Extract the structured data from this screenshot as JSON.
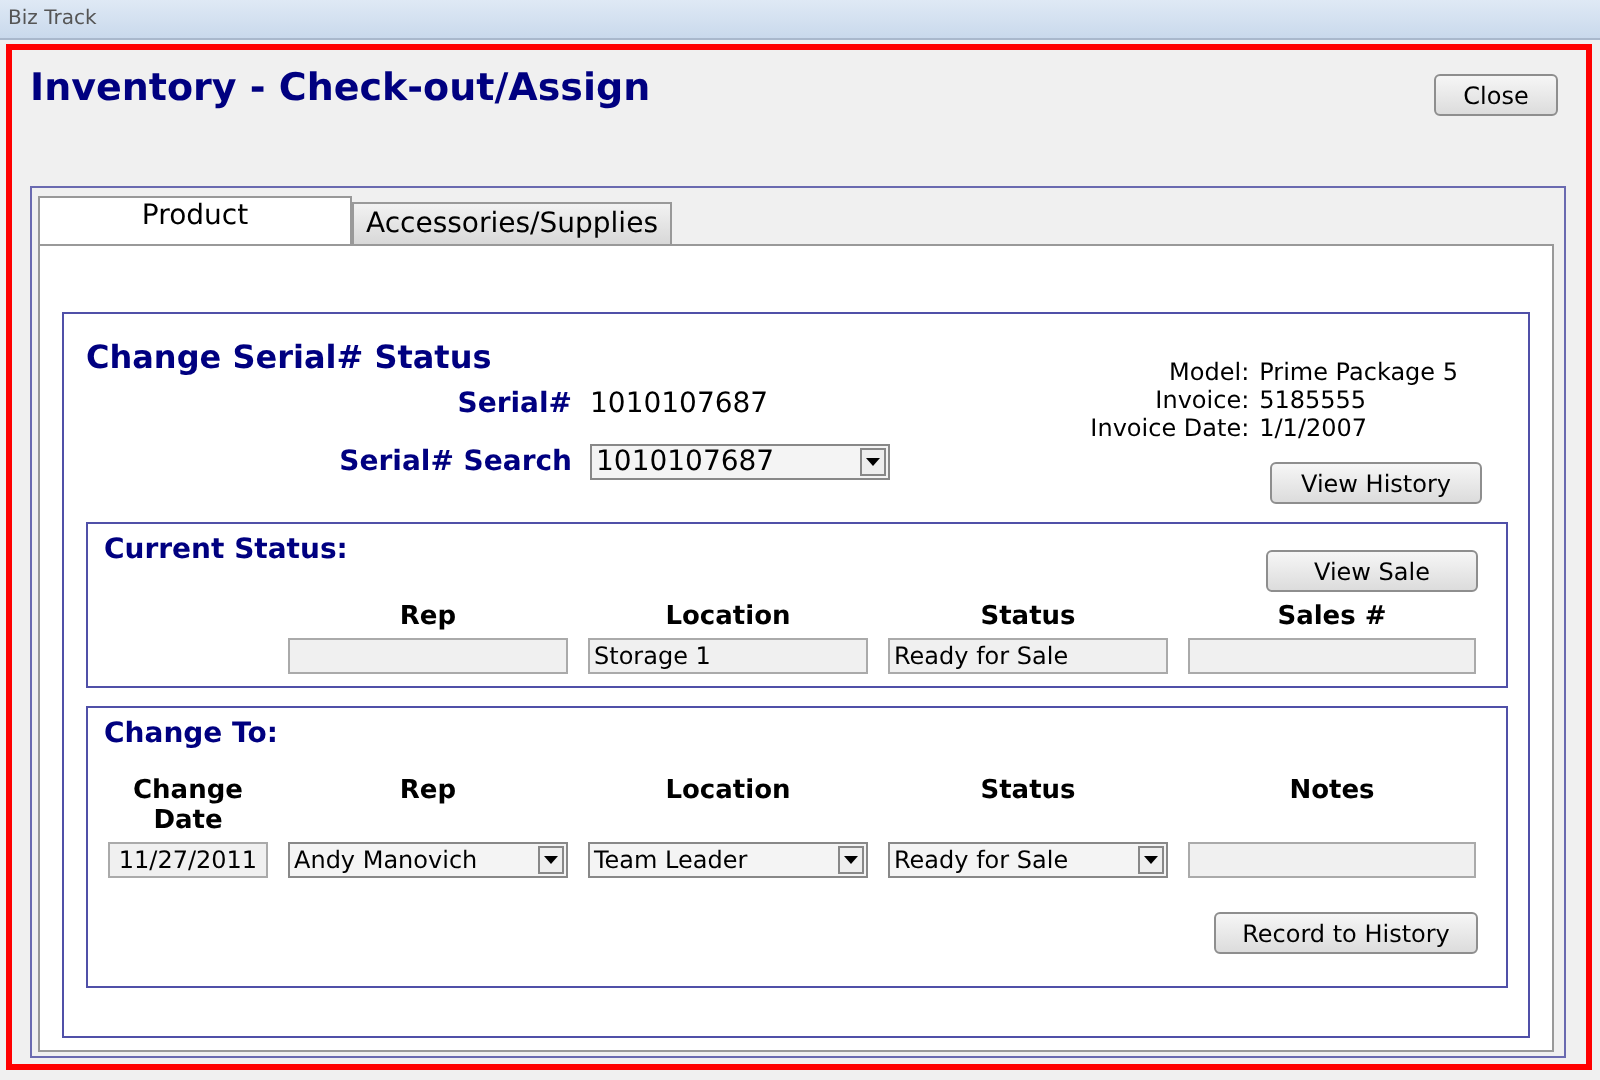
{
  "window": {
    "title": "Biz Track"
  },
  "header": {
    "title": "Inventory - Check-out/Assign",
    "close_button": "Close"
  },
  "tabs": [
    {
      "label": "Product",
      "selected": true
    },
    {
      "label": "Accessories/Supplies",
      "selected": false
    }
  ],
  "serial_status": {
    "title": "Change Serial# Status",
    "serial_label": "Serial#",
    "serial_value": "1010107687",
    "search_label": "Serial# Search",
    "search_value": "1010107687",
    "info": [
      {
        "label": "Model:",
        "value": "Prime Package 5"
      },
      {
        "label": "Invoice:",
        "value": "5185555"
      },
      {
        "label": "Invoice Date:",
        "value": "1/1/2007"
      }
    ],
    "history_button": "View History"
  },
  "current_status": {
    "title": "Current Status:",
    "button": "View Sale",
    "fields": [
      {
        "label": "Rep",
        "kind": "text"
      },
      {
        "label": "Location",
        "kind": "text",
        "value": "Storage 1"
      },
      {
        "label": "Status",
        "kind": "text",
        "value": "Ready for Sale"
      },
      {
        "label": "Sales #",
        "kind": "text"
      }
    ]
  },
  "change_to": {
    "title": "Change To:",
    "button": "Record to History",
    "fields": [
      {
        "label": "Change Date",
        "kind": "date",
        "value": "11/27/2011"
      },
      {
        "label": "Rep",
        "kind": "select",
        "value": "Andy Manovich"
      },
      {
        "label": "Location",
        "kind": "select",
        "value": "Team Leader"
      },
      {
        "label": "Status",
        "kind": "select",
        "value": "Ready for Sale"
      },
      {
        "label": "Notes",
        "kind": "text"
      }
    ]
  }
}
